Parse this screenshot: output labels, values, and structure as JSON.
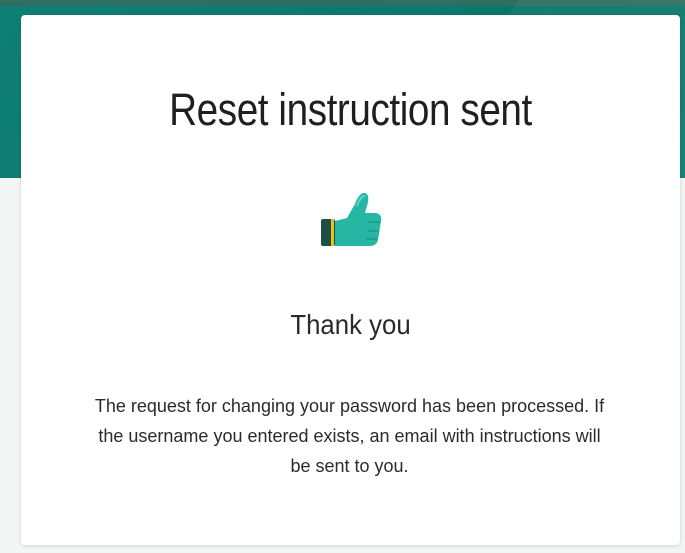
{
  "card": {
    "title": "Reset instruction sent",
    "subtitle": "Thank you",
    "message": "The request for changing your password has been processed. If the username you entered exists, an email with instructions will be sent to you."
  },
  "icons": {
    "confirmation": "thumbs-up-icon"
  },
  "colors": {
    "banner": "#0b7a6e",
    "icon_primary": "#26b6a4",
    "icon_cuff": "#1e4f45",
    "icon_band": "#e6c21b",
    "card_background": "#ffffff",
    "page_background": "#f4f5f5"
  }
}
